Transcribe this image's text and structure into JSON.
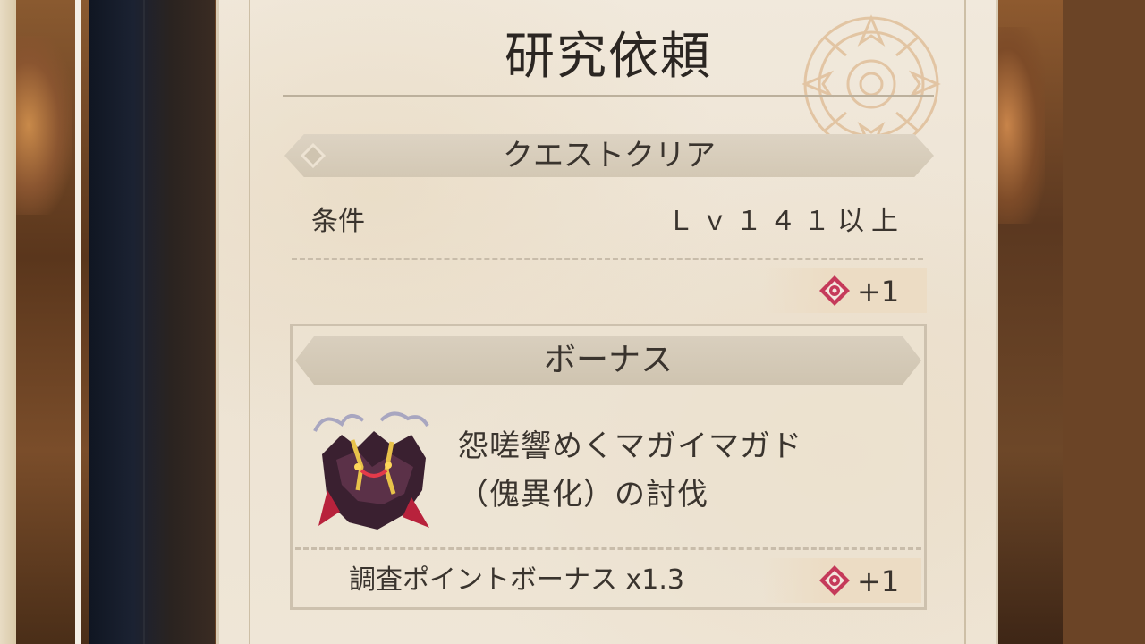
{
  "panel": {
    "title": "研究依頼",
    "quest_section_label": "クエストクリア",
    "condition_label": "条件",
    "condition_value": "Ｌｖ１４１以上",
    "clear_reward": "+1",
    "bonus_section_label": "ボーナス",
    "target_line1": "怨嗟響めくマガイマガド",
    "target_line2": "（傀異化）の討伐",
    "bonus_rate_text": "調査ポイントボーナス x1.3",
    "bonus_reward": "+1"
  },
  "icons": {
    "reward": "research-point-icon",
    "monster": "magnamalo-portrait-icon",
    "emblem": "guild-emblem-icon"
  },
  "colors": {
    "reward_icon": "#c53a5a",
    "parchment": "#efe6d7",
    "ink": "#3a342e"
  }
}
